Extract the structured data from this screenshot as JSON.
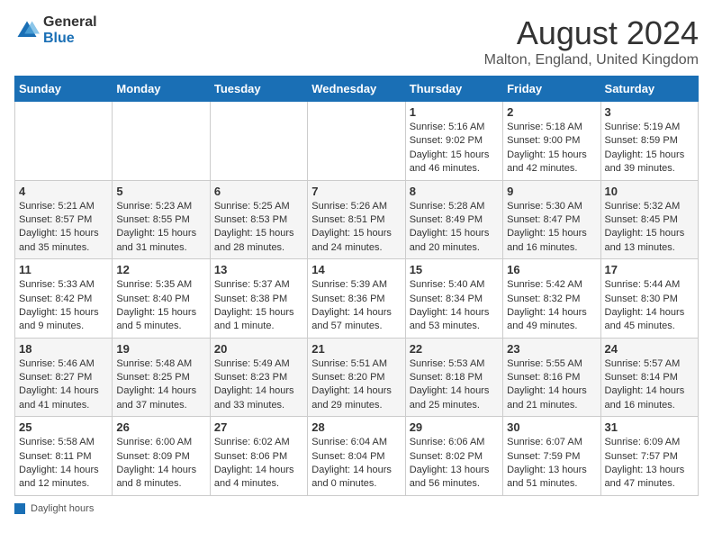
{
  "header": {
    "logo_general": "General",
    "logo_blue": "Blue",
    "title": "August 2024",
    "subtitle": "Malton, England, United Kingdom"
  },
  "columns": [
    "Sunday",
    "Monday",
    "Tuesday",
    "Wednesday",
    "Thursday",
    "Friday",
    "Saturday"
  ],
  "weeks": [
    [
      {
        "day": "",
        "info": ""
      },
      {
        "day": "",
        "info": ""
      },
      {
        "day": "",
        "info": ""
      },
      {
        "day": "",
        "info": ""
      },
      {
        "day": "1",
        "info": "Sunrise: 5:16 AM\nSunset: 9:02 PM\nDaylight: 15 hours and 46 minutes."
      },
      {
        "day": "2",
        "info": "Sunrise: 5:18 AM\nSunset: 9:00 PM\nDaylight: 15 hours and 42 minutes."
      },
      {
        "day": "3",
        "info": "Sunrise: 5:19 AM\nSunset: 8:59 PM\nDaylight: 15 hours and 39 minutes."
      }
    ],
    [
      {
        "day": "4",
        "info": "Sunrise: 5:21 AM\nSunset: 8:57 PM\nDaylight: 15 hours and 35 minutes."
      },
      {
        "day": "5",
        "info": "Sunrise: 5:23 AM\nSunset: 8:55 PM\nDaylight: 15 hours and 31 minutes."
      },
      {
        "day": "6",
        "info": "Sunrise: 5:25 AM\nSunset: 8:53 PM\nDaylight: 15 hours and 28 minutes."
      },
      {
        "day": "7",
        "info": "Sunrise: 5:26 AM\nSunset: 8:51 PM\nDaylight: 15 hours and 24 minutes."
      },
      {
        "day": "8",
        "info": "Sunrise: 5:28 AM\nSunset: 8:49 PM\nDaylight: 15 hours and 20 minutes."
      },
      {
        "day": "9",
        "info": "Sunrise: 5:30 AM\nSunset: 8:47 PM\nDaylight: 15 hours and 16 minutes."
      },
      {
        "day": "10",
        "info": "Sunrise: 5:32 AM\nSunset: 8:45 PM\nDaylight: 15 hours and 13 minutes."
      }
    ],
    [
      {
        "day": "11",
        "info": "Sunrise: 5:33 AM\nSunset: 8:42 PM\nDaylight: 15 hours and 9 minutes."
      },
      {
        "day": "12",
        "info": "Sunrise: 5:35 AM\nSunset: 8:40 PM\nDaylight: 15 hours and 5 minutes."
      },
      {
        "day": "13",
        "info": "Sunrise: 5:37 AM\nSunset: 8:38 PM\nDaylight: 15 hours and 1 minute."
      },
      {
        "day": "14",
        "info": "Sunrise: 5:39 AM\nSunset: 8:36 PM\nDaylight: 14 hours and 57 minutes."
      },
      {
        "day": "15",
        "info": "Sunrise: 5:40 AM\nSunset: 8:34 PM\nDaylight: 14 hours and 53 minutes."
      },
      {
        "day": "16",
        "info": "Sunrise: 5:42 AM\nSunset: 8:32 PM\nDaylight: 14 hours and 49 minutes."
      },
      {
        "day": "17",
        "info": "Sunrise: 5:44 AM\nSunset: 8:30 PM\nDaylight: 14 hours and 45 minutes."
      }
    ],
    [
      {
        "day": "18",
        "info": "Sunrise: 5:46 AM\nSunset: 8:27 PM\nDaylight: 14 hours and 41 minutes."
      },
      {
        "day": "19",
        "info": "Sunrise: 5:48 AM\nSunset: 8:25 PM\nDaylight: 14 hours and 37 minutes."
      },
      {
        "day": "20",
        "info": "Sunrise: 5:49 AM\nSunset: 8:23 PM\nDaylight: 14 hours and 33 minutes."
      },
      {
        "day": "21",
        "info": "Sunrise: 5:51 AM\nSunset: 8:20 PM\nDaylight: 14 hours and 29 minutes."
      },
      {
        "day": "22",
        "info": "Sunrise: 5:53 AM\nSunset: 8:18 PM\nDaylight: 14 hours and 25 minutes."
      },
      {
        "day": "23",
        "info": "Sunrise: 5:55 AM\nSunset: 8:16 PM\nDaylight: 14 hours and 21 minutes."
      },
      {
        "day": "24",
        "info": "Sunrise: 5:57 AM\nSunset: 8:14 PM\nDaylight: 14 hours and 16 minutes."
      }
    ],
    [
      {
        "day": "25",
        "info": "Sunrise: 5:58 AM\nSunset: 8:11 PM\nDaylight: 14 hours and 12 minutes."
      },
      {
        "day": "26",
        "info": "Sunrise: 6:00 AM\nSunset: 8:09 PM\nDaylight: 14 hours and 8 minutes."
      },
      {
        "day": "27",
        "info": "Sunrise: 6:02 AM\nSunset: 8:06 PM\nDaylight: 14 hours and 4 minutes."
      },
      {
        "day": "28",
        "info": "Sunrise: 6:04 AM\nSunset: 8:04 PM\nDaylight: 14 hours and 0 minutes."
      },
      {
        "day": "29",
        "info": "Sunrise: 6:06 AM\nSunset: 8:02 PM\nDaylight: 13 hours and 56 minutes."
      },
      {
        "day": "30",
        "info": "Sunrise: 6:07 AM\nSunset: 7:59 PM\nDaylight: 13 hours and 51 minutes."
      },
      {
        "day": "31",
        "info": "Sunrise: 6:09 AM\nSunset: 7:57 PM\nDaylight: 13 hours and 47 minutes."
      }
    ]
  ],
  "footer": {
    "label": "Daylight hours"
  }
}
